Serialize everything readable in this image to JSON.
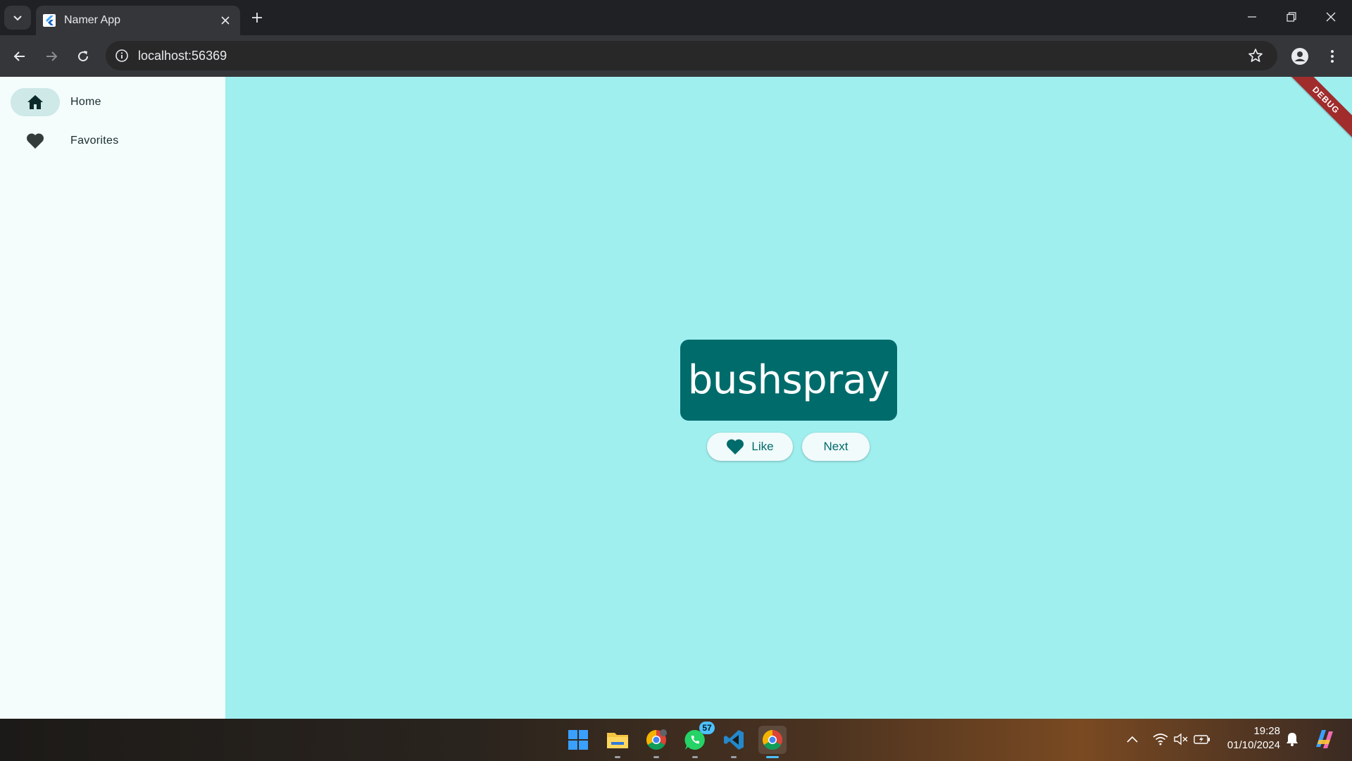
{
  "browser": {
    "tab_title": "Namer App",
    "url": "localhost:56369"
  },
  "sidebar": {
    "items": [
      {
        "label": "Home",
        "icon": "home-icon",
        "selected": true
      },
      {
        "label": "Favorites",
        "icon": "heart-icon",
        "selected": false
      }
    ]
  },
  "main": {
    "word": "bushspray",
    "like_label": "Like",
    "next_label": "Next",
    "debug_banner": "DEBUG"
  },
  "taskbar": {
    "apps": [
      "windows-start-icon",
      "file-explorer-icon",
      "chrome-profile-icon",
      "whatsapp-icon",
      "vscode-icon",
      "chrome-icon"
    ],
    "whatsapp_badge": "57",
    "time": "19:28",
    "date": "01/10/2024"
  },
  "colors": {
    "content_bg": "#a0efef",
    "sidebar_bg": "#f4fcfc",
    "card_bg": "#006b6b",
    "accent": "#006b6b",
    "debug_ribbon": "#a02c2c"
  }
}
